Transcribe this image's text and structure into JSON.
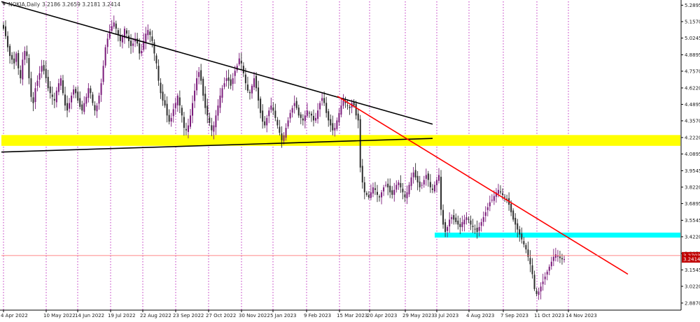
{
  "window": {
    "symbol_label": "NOKIA,Daily",
    "ohlc_text": "3.2186 3.2659 3.2181 3.2414"
  },
  "colors": {
    "background": "#ffffff",
    "candle": "#2d2d2d",
    "candle_up": "#7a1a7a",
    "grid_vertical": "#b000b0",
    "yellow_zone": "#ffff00",
    "cyan_zone": "#00ffff",
    "trendline_black": "#000000",
    "trendline_red": "#ff0000",
    "current_price_line": "#ff6060",
    "price_label_bg": "#c00000",
    "price_label_text": "#ffffff"
  },
  "chart_data": {
    "type": "candlestick",
    "title": "NOKIA,Daily",
    "y_axis": {
      "side": "right",
      "ticks": [
        "5.2895",
        "5.1570",
        "5.0245",
        "4.8895",
        "4.7570",
        "4.6220",
        "4.4895",
        "4.3570",
        "4.2220",
        "4.0895",
        "3.9545",
        "3.8220",
        "3.6895",
        "3.5545",
        "3.4220",
        "3.2870",
        "3.1545",
        "3.0220",
        "2.8870"
      ],
      "range": [
        2.83,
        5.32
      ]
    },
    "x_axis": {
      "labels": [
        "4 Apr 2022",
        "10 May 2022",
        "14 Jun 2022",
        "19 Jul 2022",
        "22 Aug 2022",
        "23 Sep 2022",
        "27 Oct 2022",
        "30 Nov 2022",
        "5 Jan 2023",
        "9 Feb 2023",
        "15 Mar 2023",
        "20 Apr 2023",
        "29 May 2023",
        "3 Jul 2023",
        "4 Aug 2023",
        "7 Sep 2023",
        "11 Oct 2023",
        "14 Nov 2023"
      ],
      "grid": "vertical dotted at each label"
    },
    "price_labels": [
      {
        "text": "3.2703",
        "value": 3.2703
      },
      {
        "text": "3.2414",
        "value": 3.2414
      }
    ],
    "current_price": 3.2414,
    "zones": [
      {
        "color": "yellow",
        "from": 4.155,
        "to": 4.242,
        "start_date": "4 Apr 2022"
      },
      {
        "color": "cyan",
        "from": 3.415,
        "to": 3.455,
        "start_date": "3 Jul 2023"
      }
    ],
    "trendlines": [
      {
        "color": "black",
        "from": [
          "4 Apr 2022",
          5.318
        ],
        "to": [
          "3 Jul 2023",
          4.33
        ]
      },
      {
        "color": "black",
        "from": [
          "4 Apr 2022",
          4.105
        ],
        "to": [
          "3 Jul 2023",
          4.215
        ]
      },
      {
        "color": "red",
        "from": [
          "15 Mar 2023",
          4.555
        ],
        "to": [
          "14 Nov 2023",
          3.12
        ]
      }
    ],
    "series_close": [
      5.1,
      5.04,
      4.95,
      4.88,
      4.85,
      4.82,
      4.9,
      4.78,
      4.7,
      4.85,
      4.92,
      4.88,
      4.7,
      4.55,
      4.5,
      4.62,
      4.68,
      4.74,
      4.8,
      4.76,
      4.7,
      4.62,
      4.58,
      4.55,
      4.52,
      4.6,
      4.66,
      4.7,
      4.58,
      4.48,
      4.44,
      4.5,
      4.56,
      4.61,
      4.58,
      4.52,
      4.47,
      4.44,
      4.5,
      4.55,
      4.62,
      4.58,
      4.5,
      4.44,
      4.48,
      4.56,
      4.66,
      4.8,
      4.95,
      5.02,
      5.08,
      5.12,
      5.15,
      5.1,
      5.05,
      5.0,
      5.04,
      5.1,
      5.06,
      5.0,
      4.96,
      4.98,
      5.02,
      4.98,
      4.9,
      4.92,
      5.0,
      5.06,
      5.09,
      5.05,
      5.0,
      4.9,
      4.82,
      4.68,
      4.58,
      4.52,
      4.48,
      4.4,
      4.35,
      4.38,
      4.45,
      4.5,
      4.56,
      4.48,
      4.4,
      4.3,
      4.28,
      4.32,
      4.4,
      4.5,
      4.6,
      4.7,
      4.75,
      4.68,
      4.56,
      4.46,
      4.4,
      4.34,
      4.28,
      4.32,
      4.4,
      4.48,
      4.56,
      4.62,
      4.66,
      4.7,
      4.68,
      4.64,
      4.7,
      4.76,
      4.8,
      4.86,
      4.82,
      4.74,
      4.66,
      4.6,
      4.58,
      4.64,
      4.7,
      4.62,
      4.52,
      4.42,
      4.35,
      4.32,
      4.38,
      4.44,
      4.48,
      4.44,
      4.38,
      4.32,
      4.26,
      4.2,
      4.24,
      4.3,
      4.36,
      4.42,
      4.46,
      4.5,
      4.46,
      4.4,
      4.38,
      4.36,
      4.4,
      4.44,
      4.42,
      4.4,
      4.36,
      4.38,
      4.44,
      4.5,
      4.54,
      4.5,
      4.42,
      4.36,
      4.32,
      4.28,
      4.3,
      4.36,
      4.42,
      4.48,
      4.52,
      4.5,
      4.48,
      4.46,
      4.5,
      4.48,
      4.4,
      4.36,
      3.98,
      3.86,
      3.78,
      3.76,
      3.74,
      3.78,
      3.82,
      3.8,
      3.76,
      3.74,
      3.78,
      3.82,
      3.84,
      3.82,
      3.78,
      3.76,
      3.8,
      3.84,
      3.86,
      3.82,
      3.78,
      3.74,
      3.78,
      3.84,
      3.9,
      3.94,
      3.9,
      3.86,
      3.82,
      3.84,
      3.88,
      3.92,
      3.88,
      3.82,
      3.8,
      3.84,
      3.88,
      3.92,
      3.64,
      3.52,
      3.46,
      3.5,
      3.56,
      3.58,
      3.56,
      3.54,
      3.52,
      3.5,
      3.54,
      3.56,
      3.58,
      3.56,
      3.52,
      3.5,
      3.48,
      3.46,
      3.5,
      3.54,
      3.58,
      3.62,
      3.66,
      3.7,
      3.72,
      3.75,
      3.78,
      3.8,
      3.78,
      3.76,
      3.74,
      3.72,
      3.68,
      3.62,
      3.56,
      3.52,
      3.48,
      3.44,
      3.4,
      3.36,
      3.32,
      3.26,
      3.2,
      3.12,
      3.0,
      2.96,
      2.98,
      3.02,
      3.06,
      3.1,
      3.14,
      3.18,
      3.22,
      3.26,
      3.28,
      3.27,
      3.25,
      3.24,
      3.2414
    ]
  }
}
